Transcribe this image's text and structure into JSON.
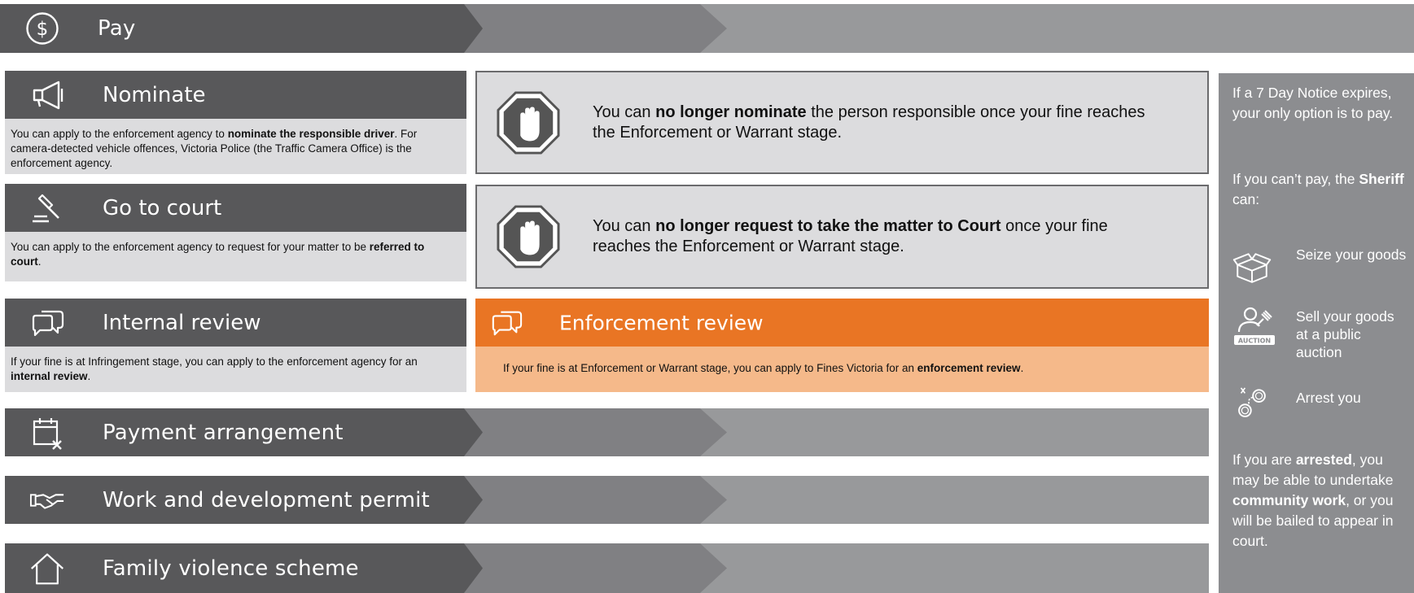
{
  "colors": {
    "dark": "#58585a",
    "mid": "#808083",
    "light": "#98999b",
    "box": "#dcdcde",
    "orange": "#e97524",
    "orange_light": "#f5b98a",
    "side": "#8c8d90"
  },
  "rows": {
    "pay": {
      "label": "Pay",
      "icon": "dollar-icon"
    },
    "nominate": {
      "label": "Nominate",
      "icon": "megaphone-icon",
      "desc": {
        "p1": "You can apply to the enforcement agency to ",
        "b1": "nominate the responsible driver",
        "p2": ". For camera-detected vehicle offences, Victoria Police (the Traffic Camera Office) is the enforcement agency."
      },
      "stop": {
        "p1": "You can ",
        "b1": "no longer nominate",
        "p2": " the person responsible once your fine reaches the Enforcement or  Warrant stage."
      }
    },
    "court": {
      "label": "Go to court",
      "icon": "gavel-icon",
      "desc": {
        "p1": "You can apply to the enforcement agency to request for your matter to be ",
        "b1": "referred to court",
        "p2": "."
      },
      "stop": {
        "p1": "You can ",
        "b1": "no longer request to take the matter to Court",
        "p2": " once your fine reaches the Enforcement or  Warrant stage."
      }
    },
    "internal_review": {
      "label": "Internal review",
      "icon": "speech-bubbles-icon",
      "desc": {
        "p1": "If your fine is at Infringement stage, you can apply to the enforcement agency for an ",
        "b1": "internal review",
        "p2": "."
      }
    },
    "enforcement_review": {
      "label": "Enforcement review",
      "icon": "speech-bubbles-icon",
      "desc": {
        "p1": "If your fine is at Enforcement or Warrant stage, you can apply to Fines Victoria for an ",
        "b1": "enforcement review",
        "p2": "."
      }
    },
    "payment_arrangement": {
      "label": "Payment arrangement",
      "icon": "calendar-icon"
    },
    "work_permit": {
      "label": "Work and development permit",
      "icon": "handshake-icon"
    },
    "family_violence": {
      "label": "Family violence scheme",
      "icon": "house-icon"
    }
  },
  "sidebar": {
    "intro": "If a 7 Day Notice expires, your only option is to pay.",
    "cant_pay_p1": "If you can’t pay, the ",
    "cant_pay_b1": "Sheriff",
    "cant_pay_p2": " can:",
    "items": [
      {
        "icon": "box-icon",
        "text": "Seize your goods"
      },
      {
        "icon": "auction-icon",
        "text": "Sell your goods at a public auction",
        "badge": "AUCTION"
      },
      {
        "icon": "handcuffs-icon",
        "text": "Arrest you"
      }
    ],
    "arrested": {
      "p1": "If you are ",
      "b1": "arrested",
      "p2": ", you may be able to undertake ",
      "b2": "community work",
      "p3": ", or you will be bailed to appear in court."
    }
  }
}
